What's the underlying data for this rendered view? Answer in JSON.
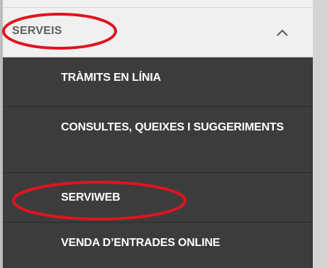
{
  "menu": {
    "header": {
      "label": "SERVEIS",
      "chevron_icon": "chevron-up-icon"
    },
    "items": [
      {
        "label": "TRÀMITS EN LÍNIA"
      },
      {
        "label": "CONSULTES, QUEIXES I SUGGERIMENTS"
      },
      {
        "label": "SERVIWEB"
      },
      {
        "label": "VENDA D’ENTRADES ONLINE"
      }
    ]
  },
  "colors": {
    "header_bg": "#f0f0f0",
    "header_text": "#5e5e5e",
    "submenu_bg": "#3c3c3c",
    "submenu_text": "#ffffff",
    "annotation": "#e0141e"
  },
  "annotations": [
    "highlight-ellipse-serveis",
    "highlight-ellipse-serviweb"
  ]
}
